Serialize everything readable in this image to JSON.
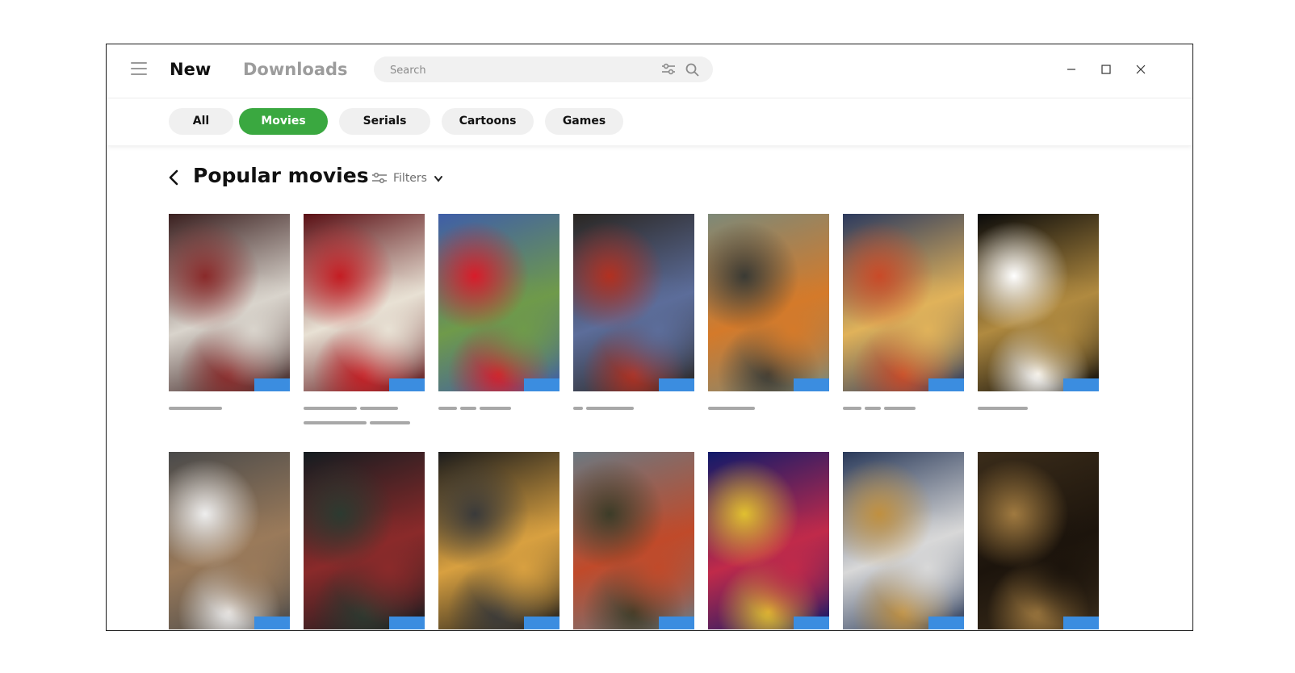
{
  "header": {
    "tabs": [
      {
        "label": "New",
        "active": true
      },
      {
        "label": "Downloads",
        "active": false
      }
    ],
    "search": {
      "placeholder": "Search",
      "value": ""
    },
    "icons": [
      "menu-icon",
      "filter-sliders-icon",
      "search-icon",
      "minimize-icon",
      "maximize-icon",
      "close-icon"
    ]
  },
  "categories": [
    {
      "label": "All",
      "active": false
    },
    {
      "label": "Movies",
      "active": true
    },
    {
      "label": "Serials",
      "active": false
    },
    {
      "label": "Cartoons",
      "active": false
    },
    {
      "label": "Games",
      "active": false
    }
  ],
  "section": {
    "title": "Popular movies",
    "filters_label": "Filters"
  },
  "colors": {
    "accent": "#3aa840",
    "badge": "#3b8de0",
    "placeholder_bar": "#a8a8a8",
    "chip_bg": "#f0f0f0"
  },
  "movies": [
    {
      "palette": [
        "#3a1f1f",
        "#8a2a2a",
        "#d9d4cc"
      ]
    },
    {
      "palette": [
        "#5a0f14",
        "#c41d23",
        "#e8e1d4"
      ]
    },
    {
      "palette": [
        "#3f5ea8",
        "#d81c2a",
        "#6f9a4a"
      ]
    },
    {
      "palette": [
        "#2a2622",
        "#b23020",
        "#5c6d9a"
      ]
    },
    {
      "palette": [
        "#7d8978",
        "#3a3a34",
        "#d47a2a"
      ]
    },
    {
      "palette": [
        "#2c3a5e",
        "#c94a28",
        "#e0b25a"
      ]
    },
    {
      "palette": [
        "#0a0a0a",
        "#ffffff",
        "#b08a40"
      ]
    },
    {
      "palette": [
        "#4a4a4a",
        "#eeeeee",
        "#9a7a5a"
      ]
    },
    {
      "palette": [
        "#141c20",
        "#2c3a30",
        "#8a2a2a"
      ]
    },
    {
      "palette": [
        "#1c1c1c",
        "#3a3a3a",
        "#d8a040"
      ]
    },
    {
      "palette": [
        "#6c7880",
        "#3c3c28",
        "#c04a2a"
      ]
    },
    {
      "palette": [
        "#101a6a",
        "#e0c030",
        "#c02a4a"
      ]
    },
    {
      "palette": [
        "#2a3a5a",
        "#c09040",
        "#d8d8d8"
      ]
    },
    {
      "palette": [
        "#3a2c1a",
        "#a07a40",
        "#1c140c"
      ]
    }
  ]
}
